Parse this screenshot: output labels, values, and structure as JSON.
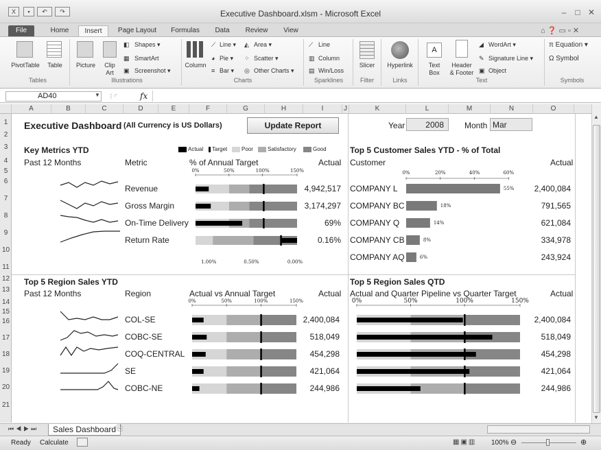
{
  "window": {
    "title": "Executive Dashboard.xlsm - Microsoft Excel"
  },
  "ribbon_tabs": [
    "File",
    "Home",
    "Insert",
    "Page Layout",
    "Formulas",
    "Data",
    "Review",
    "View"
  ],
  "ribbon": {
    "tables": {
      "pivottable": "PivotTable",
      "table": "Table",
      "group": "Tables"
    },
    "illustrations": {
      "picture": "Picture",
      "clip_art_1": "Clip",
      "clip_art_2": "Art",
      "shapes": "Shapes ▾",
      "smartart": "SmartArt",
      "screenshot": "Screenshot ▾",
      "group": "Illustrations"
    },
    "charts": {
      "column": "Column",
      "line": "Line ▾",
      "pie": "Pie ▾",
      "bar": "Bar ▾",
      "area": "Area ▾",
      "scatter": "Scatter ▾",
      "other": "Other Charts ▾",
      "group": "Charts"
    },
    "sparklines": {
      "line": "Line",
      "column": "Column",
      "winloss": "Win/Loss",
      "group": "Sparklines"
    },
    "filter": {
      "slicer": "Slicer",
      "group": "Filter"
    },
    "links": {
      "hyperlink": "Hyperlink",
      "group": "Links"
    },
    "text": {
      "textbox_1": "Text",
      "textbox_2": "Box",
      "header_1": "Header",
      "header_2": "& Footer",
      "wordart": "WordArt ▾",
      "signature": "Signature Line ▾",
      "object": "Object",
      "group": "Text"
    },
    "symbols": {
      "equation": "π Equation ▾",
      "symbol": "Ω Symbol",
      "group": "Symbols"
    }
  },
  "formula_bar": {
    "name_box": "AD40",
    "fx": "fx",
    "value": ""
  },
  "columns": [
    "A",
    "B",
    "C",
    "D",
    "E",
    "F",
    "G",
    "H",
    "I",
    "J",
    "K",
    "L",
    "M",
    "N",
    "O"
  ],
  "rows": [
    "1",
    "2",
    "3",
    "4",
    "5",
    "6",
    "7",
    "8",
    "9",
    "10",
    "11",
    "12",
    "13",
    "14",
    "15",
    "16",
    "17",
    "18",
    "19",
    "20",
    "21"
  ],
  "dashboard": {
    "title": "Executive Dashboard",
    "subtitle": "(All Currency is US Dollars)",
    "update_button": "Update Report",
    "year_label": "Year",
    "year_value": "2008",
    "month_label": "Month",
    "month_value": "Mar",
    "legend": {
      "actual": "Actual",
      "target": "Target",
      "poor": "Poor",
      "satisfactory": "Satisfactory",
      "good": "Good"
    },
    "key_metrics": {
      "title": "Key Metrics YTD",
      "period": "Past 12 Months",
      "col_metric": "Metric",
      "col_target": "% of Annual Target",
      "col_actual": "Actual",
      "axis_top": [
        "0%",
        "50%",
        "100%",
        "150%"
      ],
      "axis_bottom": [
        "1.00%",
        "0.50%",
        "0.00%"
      ],
      "rows": [
        {
          "name": "Revenue",
          "actual": "4,942,517",
          "bar": 0.13,
          "target": 0.67
        },
        {
          "name": "Gross Margin",
          "actual": "3,174,297",
          "bar": 0.15,
          "target": 0.67
        },
        {
          "name": "On-Time Delivery",
          "actual": "69%",
          "bar": 0.46,
          "target": 0.67
        },
        {
          "name": "Return Rate",
          "actual": "0.16%",
          "bar": 0.16,
          "target": 0.84
        }
      ]
    },
    "customers": {
      "title": "Top 5 Customer Sales YTD - % of Total",
      "col_customer": "Customer",
      "col_actual": "Actual",
      "axis": [
        "0%",
        "20%",
        "40%",
        "60%"
      ],
      "rows": [
        {
          "name": "COMPANY L",
          "pct": 55,
          "pct_label": "55%",
          "actual": "2,400,084"
        },
        {
          "name": "COMPANY BC",
          "pct": 18,
          "pct_label": "18%",
          "actual": "791,565"
        },
        {
          "name": "COMPANY Q",
          "pct": 14,
          "pct_label": "14%",
          "actual": "621,084"
        },
        {
          "name": "COMPANY CB",
          "pct": 8,
          "pct_label": "8%",
          "actual": "334,978"
        },
        {
          "name": "COMPANY AQ",
          "pct": 6,
          "pct_label": "6%",
          "actual": "243,924"
        }
      ]
    },
    "regions_ytd": {
      "title": "Top 5 Region Sales YTD",
      "period": "Past 12 Months",
      "col_region": "Region",
      "col_target": "Actual vs Annual Target",
      "col_actual": "Actual",
      "axis": [
        "0%",
        "50%",
        "100%",
        "150%"
      ],
      "rows": [
        {
          "name": "COL-SE",
          "actual": "2,400,084",
          "bar": 0.11
        },
        {
          "name": "COBC-SE",
          "actual": "518,049",
          "bar": 0.14
        },
        {
          "name": "COQ-CENTRAL",
          "actual": "454,298",
          "bar": 0.13
        },
        {
          "name": "SE",
          "actual": "421,064",
          "bar": 0.11
        },
        {
          "name": "COBC-NE",
          "actual": "244,986",
          "bar": 0.07
        }
      ]
    },
    "regions_qtd": {
      "title": "Top 5 Region Sales QTD",
      "subtitle": "Actual and Quarter Pipeline vs Quarter Target",
      "col_actual": "Actual",
      "axis": [
        "0%",
        "50%",
        "100%",
        "150%"
      ],
      "rows": [
        {
          "actual": "2,400,084",
          "bar": 0.65
        },
        {
          "actual": "518,049",
          "bar": 0.83
        },
        {
          "actual": "454,298",
          "bar": 0.73
        },
        {
          "actual": "421,064",
          "bar": 0.69
        },
        {
          "actual": "244,986",
          "bar": 0.39
        }
      ]
    }
  },
  "sheet_tab": "Sales Dashboard",
  "status": {
    "ready": "Ready",
    "calculate": "Calculate",
    "zoom": "100%"
  }
}
